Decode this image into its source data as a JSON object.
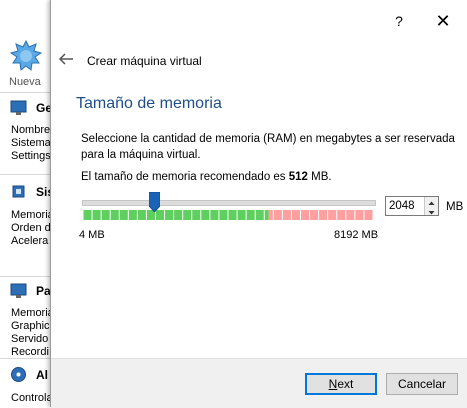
{
  "background_window": {
    "toolbar": {
      "new_label": "Nueva"
    },
    "sections": [
      {
        "title": "Ge",
        "lines": [
          "Nombre",
          "Sistema",
          "Settings"
        ]
      },
      {
        "title": "Sis",
        "lines": [
          "Memoria",
          "Orden d",
          "Acelera"
        ]
      },
      {
        "title": "Pa",
        "lines": [
          "Memoria",
          "Graphic",
          "Servido",
          "Recordi"
        ]
      },
      {
        "title": "Al",
        "lines": [
          "Controla"
        ]
      }
    ]
  },
  "dialog": {
    "help_glyph": "?",
    "close_glyph": "✕",
    "wizard_title": "Crear máquina virtual",
    "heading": "Tamaño de memoria",
    "description": "Seleccione la cantidad de memoria (RAM) en megabytes a ser reservada para la máquina virtual.",
    "recommend_prefix": "El tamaño de memoria recomendado es ",
    "recommend_value": "512",
    "recommend_suffix": " MB.",
    "slider": {
      "min_label": "4 MB",
      "max_label": "8192 MB",
      "min": 4,
      "max": 8192,
      "value": 2048,
      "green_fraction": 0.64,
      "red_fraction": 0.36
    },
    "spinbox_value": "2048",
    "unit_label": "MB",
    "next_prefix": "",
    "next_accel": "N",
    "next_rest": "ext",
    "cancel_label": "Cancelar"
  },
  "colors": {
    "heading": "#1f4e8c",
    "scale_green": "#5fcf5f",
    "scale_red": "#ff9f9f",
    "thumb": "#1b63b7",
    "default_button_border": "#0078d7"
  }
}
